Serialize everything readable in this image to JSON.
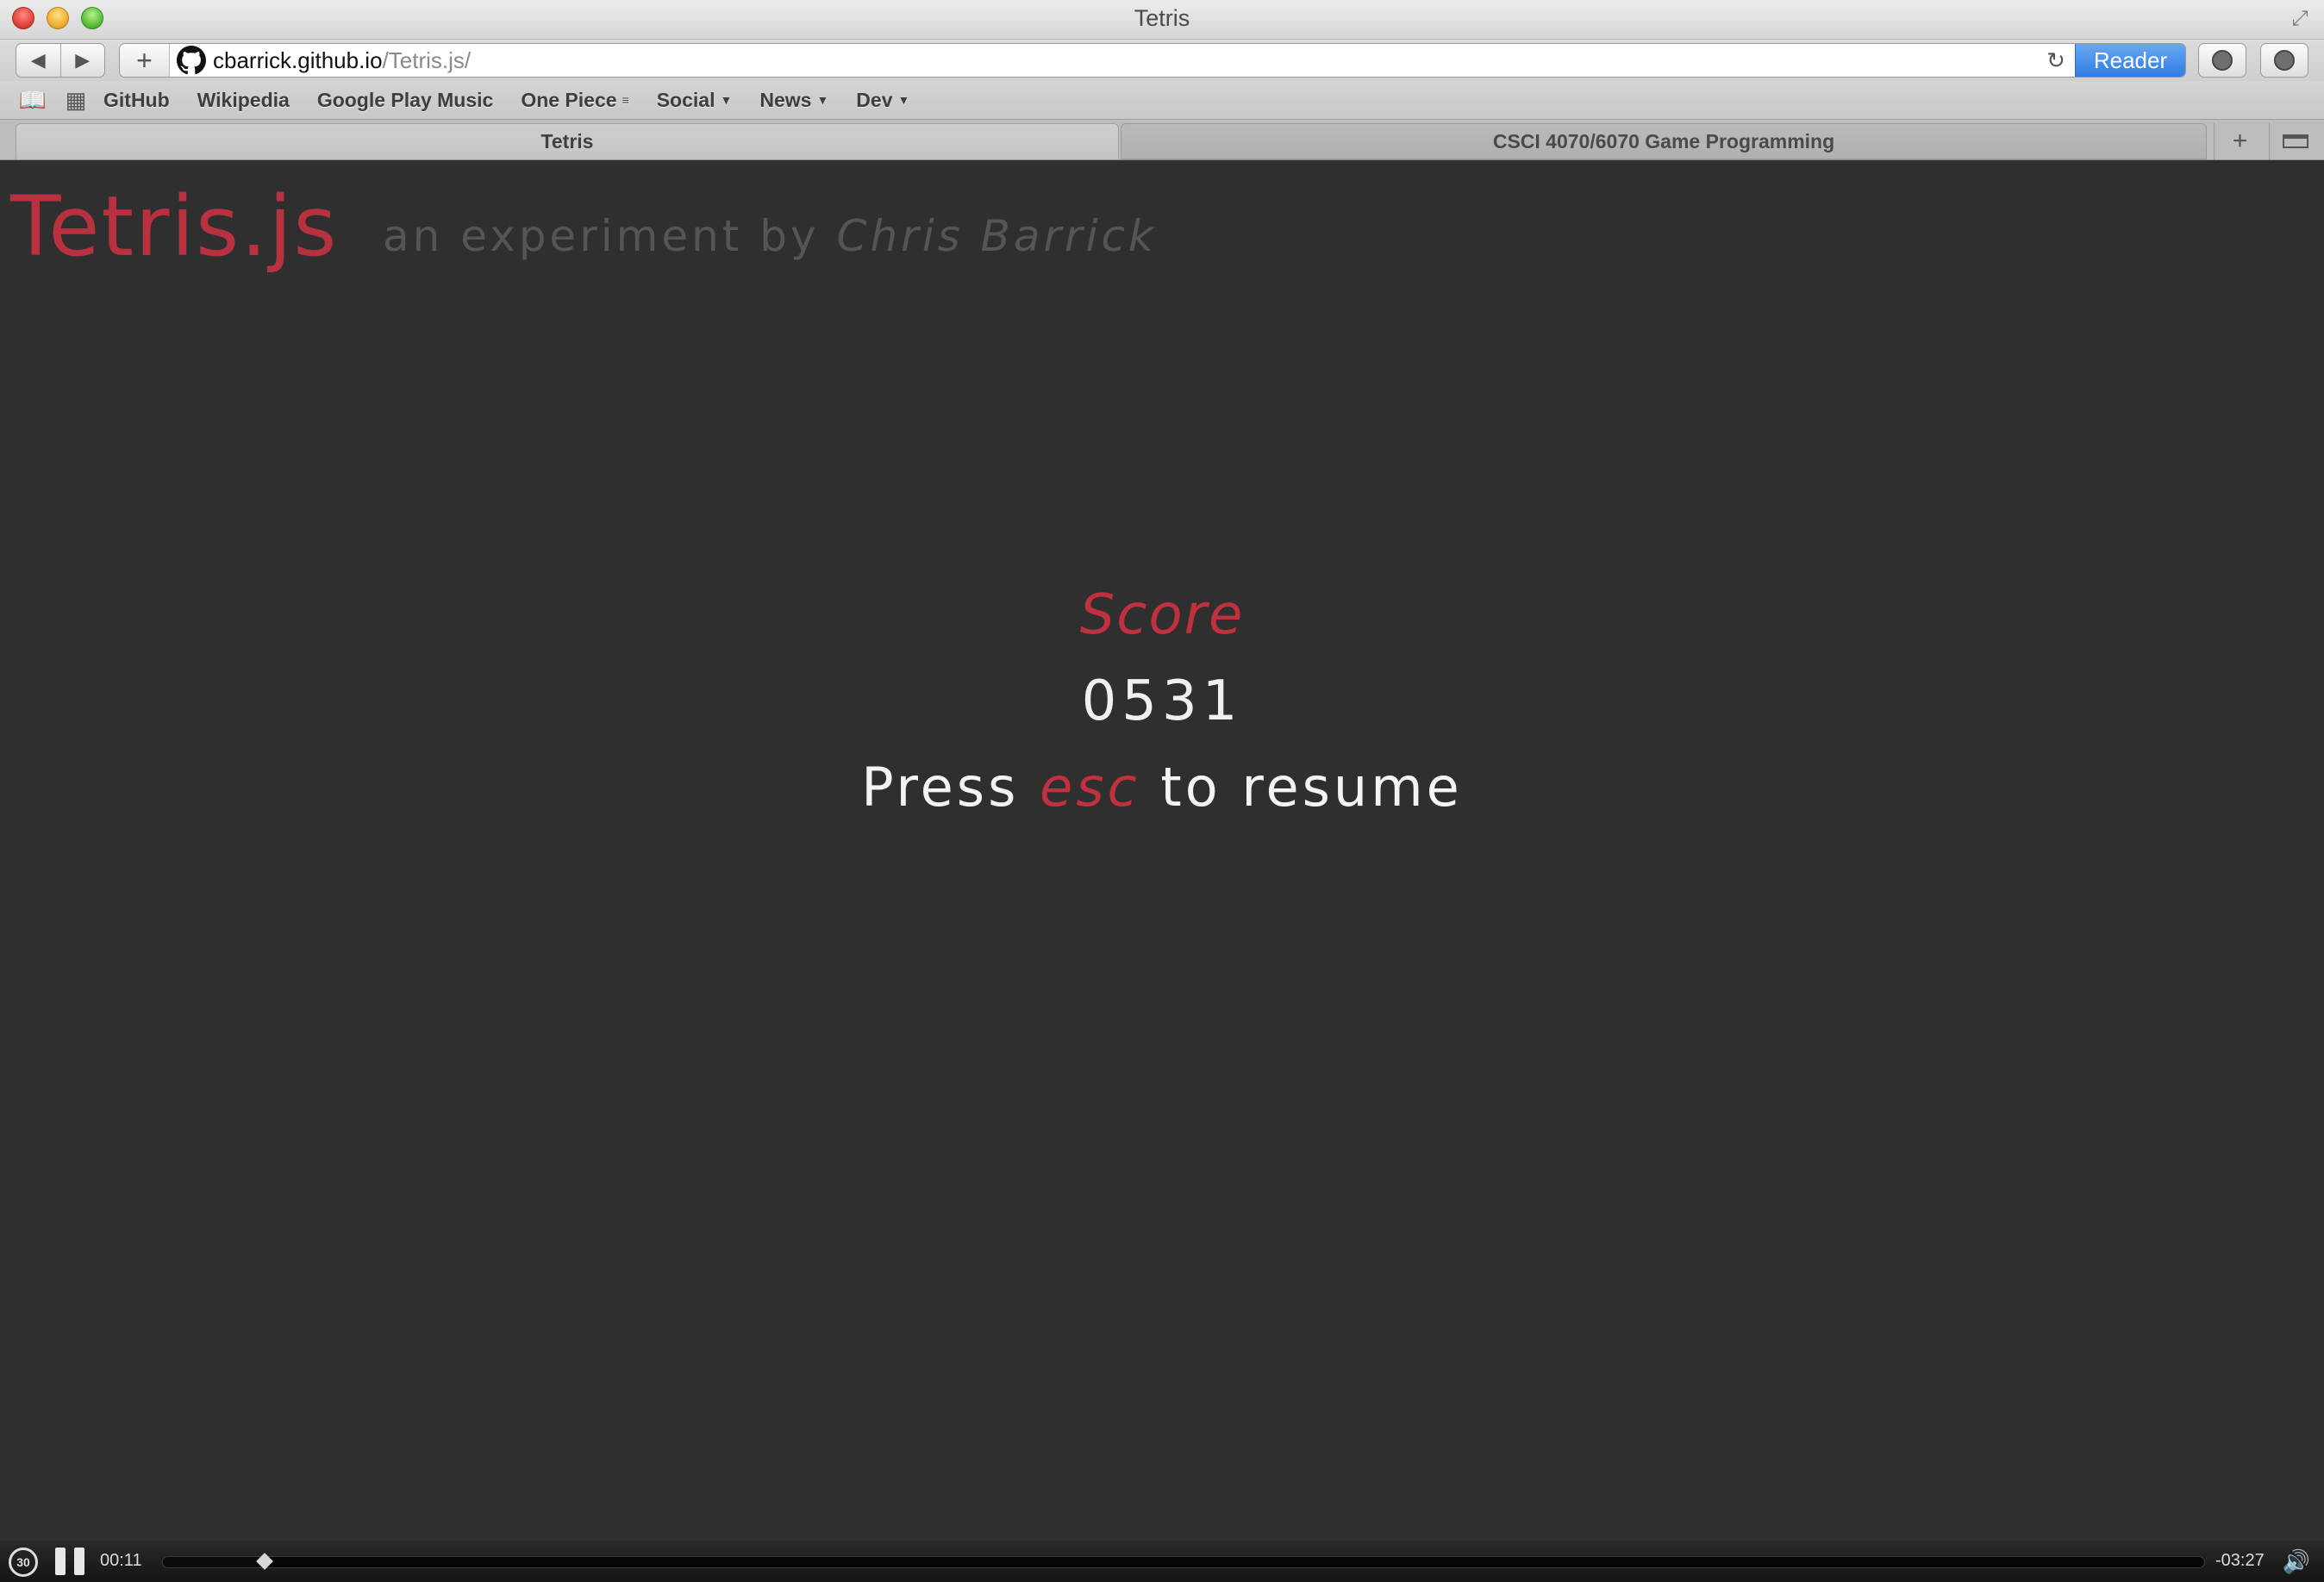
{
  "window": {
    "title": "Tetris"
  },
  "toolbar": {
    "back_icon": "back-arrow-icon",
    "forward_icon": "forward-arrow-icon",
    "add_icon": "plus-icon",
    "url_host": "cbarrick.github.io",
    "url_path": "/Tetris.js/",
    "reader_label": "Reader",
    "accent_color": "#2f7be2"
  },
  "bookmarks": {
    "items": [
      {
        "label": "GitHub",
        "has_menu": false
      },
      {
        "label": "Wikipedia",
        "has_menu": false
      },
      {
        "label": "Google Play Music",
        "has_menu": false
      },
      {
        "label": "One Piece",
        "has_menu": true
      },
      {
        "label": "Social",
        "has_menu": true
      },
      {
        "label": "News",
        "has_menu": true
      },
      {
        "label": "Dev",
        "has_menu": true
      }
    ]
  },
  "tabs": [
    {
      "label": "Tetris",
      "active": true
    },
    {
      "label": "CSCI 4070/6070 Game Programming",
      "active": false
    }
  ],
  "page": {
    "logo": "Tetris.js",
    "subtitle_prefix": "an experiment by ",
    "author": "Chris Barrick",
    "score_label": "Score",
    "score_value": "0531",
    "resume_prefix": "Press ",
    "resume_key": "esc",
    "resume_suffix": " to resume",
    "accent_color": "#c0303e"
  },
  "video_controller": {
    "rewind_label": "30",
    "elapsed": "00:11",
    "remaining": "-03:27",
    "progress_fraction": 0.05
  }
}
